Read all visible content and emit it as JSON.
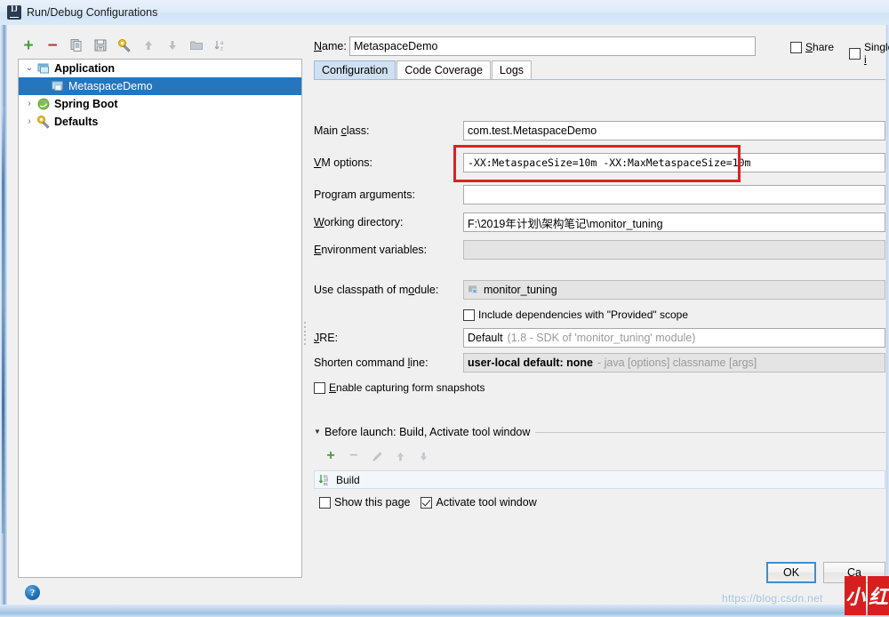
{
  "window": {
    "title": "Run/Debug Configurations",
    "icon": "intellij-idea-icon"
  },
  "left_panel": {
    "toolbar": [
      {
        "name": "add-configuration-button",
        "icon": "plus-icon",
        "label": "+"
      },
      {
        "name": "remove-configuration-button",
        "icon": "minus-icon",
        "label": "−"
      },
      {
        "name": "copy-configuration-button",
        "icon": "copy-icon",
        "label": ""
      },
      {
        "name": "save-configuration-button",
        "icon": "save-icon",
        "label": ""
      },
      {
        "name": "edit-defaults-button",
        "icon": "wrench-icon",
        "label": ""
      },
      {
        "name": "move-up-button",
        "icon": "arrow-up-icon",
        "label": ""
      },
      {
        "name": "move-down-button",
        "icon": "arrow-down-icon",
        "label": ""
      },
      {
        "name": "new-folder-button",
        "icon": "folder-icon",
        "label": ""
      },
      {
        "name": "sort-alphabetically-button",
        "icon": "sort-az-icon",
        "label": ""
      }
    ],
    "tree": [
      {
        "label": "Application",
        "icon": "application-icon",
        "twisty": "⌄",
        "expanded": true,
        "level": 1,
        "selected": false
      },
      {
        "label": "MetaspaceDemo",
        "icon": "run-config-icon",
        "twisty": "",
        "expanded": false,
        "level": 2,
        "selected": true
      },
      {
        "label": "Spring Boot",
        "icon": "spring-boot-icon",
        "twisty": "›",
        "expanded": false,
        "level": 1,
        "selected": false
      },
      {
        "label": "Defaults",
        "icon": "defaults-wrench-icon",
        "twisty": "›",
        "expanded": false,
        "level": 1,
        "selected": false
      }
    ],
    "help_button": "?"
  },
  "right_panel": {
    "name_label": "Name:",
    "name_value": "MetaspaceDemo",
    "share_label": "Share",
    "share_checked": false,
    "single_instance_label": "Single i",
    "single_instance_checked": false,
    "tabs": [
      {
        "label": "Configuration",
        "active": true
      },
      {
        "label": "Code Coverage",
        "active": false
      },
      {
        "label": "Logs",
        "active": false
      }
    ],
    "fields": {
      "main_class_label": "Main class:",
      "main_class_value": "com.test.MetaspaceDemo",
      "vm_options_label": "VM options:",
      "vm_options_value": "-XX:MetaspaceSize=10m -XX:MaxMetaspaceSize=10m",
      "program_arguments_label": "Program arguments:",
      "program_arguments_value": "",
      "working_directory_label": "Working directory:",
      "working_directory_value": "F:\\2019年计划\\架构笔记\\monitor_tuning",
      "environment_variables_label": "Environment variables:",
      "environment_variables_value": "",
      "use_classpath_label": "Use classpath of module:",
      "use_classpath_value": "monitor_tuning",
      "include_dependencies_label": "Include dependencies with \"Provided\" scope",
      "include_dependencies_checked": false,
      "jre_label": "JRE:",
      "jre_value": "Default",
      "jre_hint": "(1.8 - SDK of 'monitor_tuning' module)",
      "shorten_command_line_label": "Shorten command line:",
      "shorten_command_line_value": "user-local default: none",
      "shorten_command_line_hint": "- java [options] classname [args]",
      "enable_capturing_label": "Enable capturing form snapshots",
      "enable_capturing_checked": false
    },
    "before_launch": {
      "header": "Before launch: Build, Activate tool window",
      "toolbar": [
        {
          "name": "add-task-button",
          "icon": "plus-icon",
          "label": "+"
        },
        {
          "name": "remove-task-button",
          "icon": "minus-icon",
          "label": "−"
        },
        {
          "name": "edit-task-button",
          "icon": "pencil-icon",
          "label": ""
        },
        {
          "name": "move-task-up-button",
          "icon": "arrow-up-icon",
          "label": ""
        },
        {
          "name": "move-task-down-button",
          "icon": "arrow-down-icon",
          "label": ""
        }
      ],
      "tasks": [
        {
          "label": "Build",
          "icon": "build-icon"
        }
      ],
      "show_page_label": "Show this page",
      "show_page_checked": false,
      "activate_tool_window_label": "Activate tool window",
      "activate_tool_window_checked": true
    },
    "buttons": {
      "ok_label": "OK",
      "cancel_label": "Ca"
    }
  },
  "annotation": {
    "highlight_color": "#e02020",
    "target": "vm-options-field"
  },
  "watermark": {
    "text": "https://blog.csdn.net",
    "logo_chars": [
      "小",
      "红"
    ]
  }
}
